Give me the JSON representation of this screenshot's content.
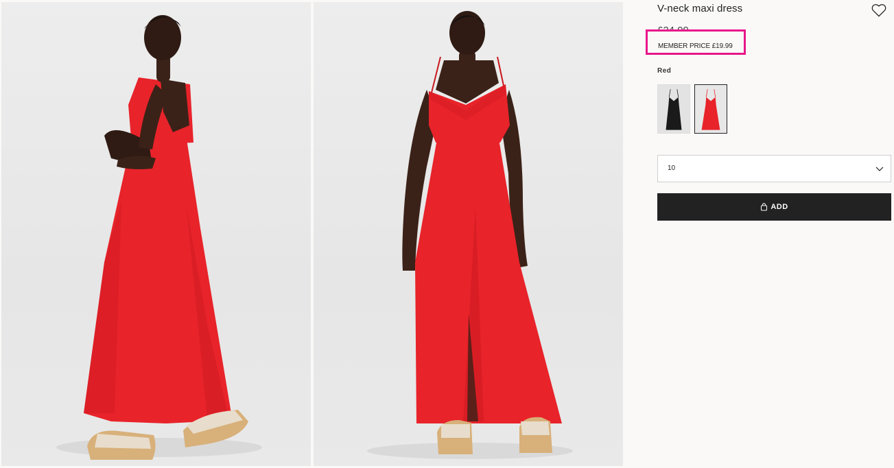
{
  "product": {
    "title": "V-neck maxi dress",
    "price": "£24.99",
    "member_price": "MEMBER PRICE £19.99",
    "color_name": "Red"
  },
  "swatches": [
    {
      "name": "Black",
      "color": "#1a1a1a",
      "selected": false
    },
    {
      "name": "Red",
      "color": "#e8232a",
      "selected": true
    }
  ],
  "size_select": {
    "value": "10"
  },
  "add_button": {
    "label": "ADD"
  },
  "colors": {
    "highlight_border": "#e8168a",
    "button_bg": "#222222",
    "dress_red": "#e8232a"
  },
  "icons": {
    "favorite": "heart-outline-icon",
    "dropdown": "chevron-down-icon",
    "add": "shopping-bag-icon"
  }
}
